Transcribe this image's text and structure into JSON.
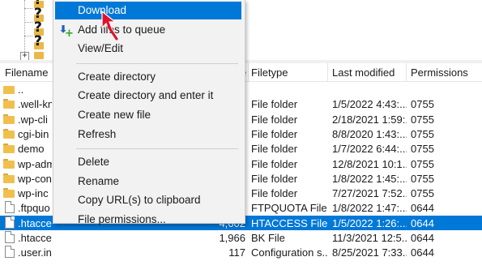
{
  "tree": {
    "expander_symbol": "+"
  },
  "filelist": {
    "columns": {
      "filename": "Filename",
      "filesize": "e",
      "filetype": "Filetype",
      "last_modified": "Last modified",
      "permissions": "Permissions"
    },
    "rows": [
      {
        "name": "..",
        "size": "",
        "type": "",
        "modified": "",
        "perms": "",
        "icon": "up-folder-icon"
      },
      {
        "name": ".well-kn",
        "size": "",
        "type": "File folder",
        "modified": "1/5/2022 4:43:...",
        "perms": "0755",
        "icon": "folder-icon"
      },
      {
        "name": ".wp-cli",
        "size": "",
        "type": "File folder",
        "modified": "2/18/2021 1:59:...",
        "perms": "0755",
        "icon": "folder-icon"
      },
      {
        "name": "cgi-bin",
        "size": "",
        "type": "File folder",
        "modified": "8/8/2020 1:43:...",
        "perms": "0755",
        "icon": "folder-icon"
      },
      {
        "name": "demo",
        "size": "",
        "type": "File folder",
        "modified": "1/7/2022 6:44:...",
        "perms": "0755",
        "icon": "folder-icon"
      },
      {
        "name": "wp-adm",
        "size": "",
        "type": "File folder",
        "modified": "12/8/2021 10:1...",
        "perms": "0755",
        "icon": "folder-icon"
      },
      {
        "name": "wp-con",
        "size": "",
        "type": "File folder",
        "modified": "1/8/2022 1:45:...",
        "perms": "0755",
        "icon": "folder-icon"
      },
      {
        "name": "wp-inc",
        "size": "",
        "type": "File folder",
        "modified": "7/27/2021 7:52...",
        "perms": "0755",
        "icon": "folder-icon"
      },
      {
        "name": ".ftpquo",
        "size": "6",
        "type": "FTPQUOTA File",
        "modified": "1/8/2022 1:47:...",
        "perms": "0644",
        "icon": "file-icon"
      },
      {
        "name": ".htaccess",
        "size": "4,602",
        "type": "HTACCESS File",
        "modified": "1/5/2022 1:26:...",
        "perms": "0644",
        "icon": "file-icon",
        "selected": true
      },
      {
        "name": ".htaccess.bk",
        "size": "1,966",
        "type": "BK File",
        "modified": "11/3/2021 12:5...",
        "perms": "0644",
        "icon": "file-icon"
      },
      {
        "name": ".user.ini",
        "size": "117",
        "type": "Configuration s...",
        "modified": "8/25/2021 7:33...",
        "perms": "0644",
        "icon": "file-icon"
      }
    ]
  },
  "context_menu": {
    "items": [
      {
        "label": "Download",
        "highlighted": true
      },
      {
        "label": "Add files to queue",
        "icon": "add-to-queue-icon"
      },
      {
        "label": "View/Edit"
      },
      {
        "separator": true
      },
      {
        "label": "Create directory"
      },
      {
        "label": "Create directory and enter it"
      },
      {
        "label": "Create new file"
      },
      {
        "label": "Refresh"
      },
      {
        "separator": true
      },
      {
        "label": "Delete"
      },
      {
        "label": "Rename"
      },
      {
        "label": "Copy URL(s) to clipboard"
      },
      {
        "label": "File permissions..."
      }
    ]
  },
  "colors": {
    "selection": "#0078d7",
    "folder": "#f0c04e",
    "annotation_arrow": "#e0102a"
  }
}
